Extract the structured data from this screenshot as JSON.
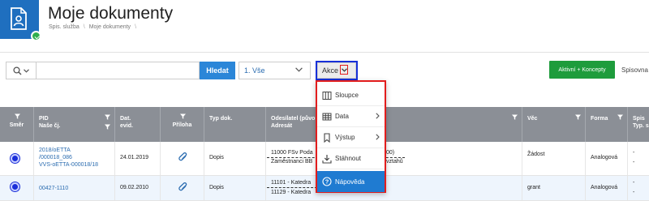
{
  "header": {
    "title": "Moje dokumenty",
    "breadcrumb": [
      "Spis. služba",
      "Moje dokumenty"
    ]
  },
  "toolbar": {
    "search_button": "Hledat",
    "search_value": "",
    "filter_value": "1. Vše",
    "akce_label": "Akce",
    "green_button": "Aktivní + Koncepty",
    "right_label": "Spisovna"
  },
  "table": {
    "columns": {
      "smer": "Směr",
      "pid": "PID\nNaše čj.",
      "datum": "Dat.\nevid.",
      "priloha": "Příloha",
      "typ": "Typ dok.",
      "odesilatel": "Odesílatel (půvo\nAdresát",
      "vec": "Věc",
      "forma": "Forma",
      "spis": "Spis\nTyp. s"
    },
    "rows": [
      {
        "pid": [
          "2018/oETTA",
          "/000018_086",
          "VVS-oETTA-000018/18"
        ],
        "datum": "24.01.2019",
        "typ": "Dopis",
        "odesilatel_1": "11000 FSv Poda",
        "odesilatel_1b": "00)",
        "odesilatel_2": "Zaměstnanci BB",
        "odesilatel_2b": "vztahů",
        "vec": "Žádost",
        "forma": "Analogová",
        "spis": "-"
      },
      {
        "pid": [
          "00427-1110"
        ],
        "datum": "09.02.2010",
        "typ": "Dopis",
        "odesilatel_1": "11101 - Katedra",
        "odesilatel_2": "11129 - Katedra",
        "vec": "grant",
        "forma": "Analogová",
        "spis": "-"
      }
    ]
  },
  "menu": {
    "items": [
      {
        "label": "Sloupce",
        "icon": "columns-icon"
      },
      {
        "label": "Data",
        "icon": "table-data-icon",
        "submenu": true
      },
      {
        "label": "Výstup",
        "icon": "bookmark-icon",
        "submenu": true
      },
      {
        "label": "Stáhnout",
        "icon": "download-icon"
      },
      {
        "label": "Nápověda",
        "icon": "help-icon",
        "active": true
      }
    ]
  },
  "colors": {
    "brand_blue": "#1f6fbf",
    "button_blue": "#2b86d8",
    "green": "#1e9c3c",
    "highlight_red": "#e21d1d",
    "highlight_blue": "#1830d8",
    "header_gray": "#8b8f96"
  }
}
